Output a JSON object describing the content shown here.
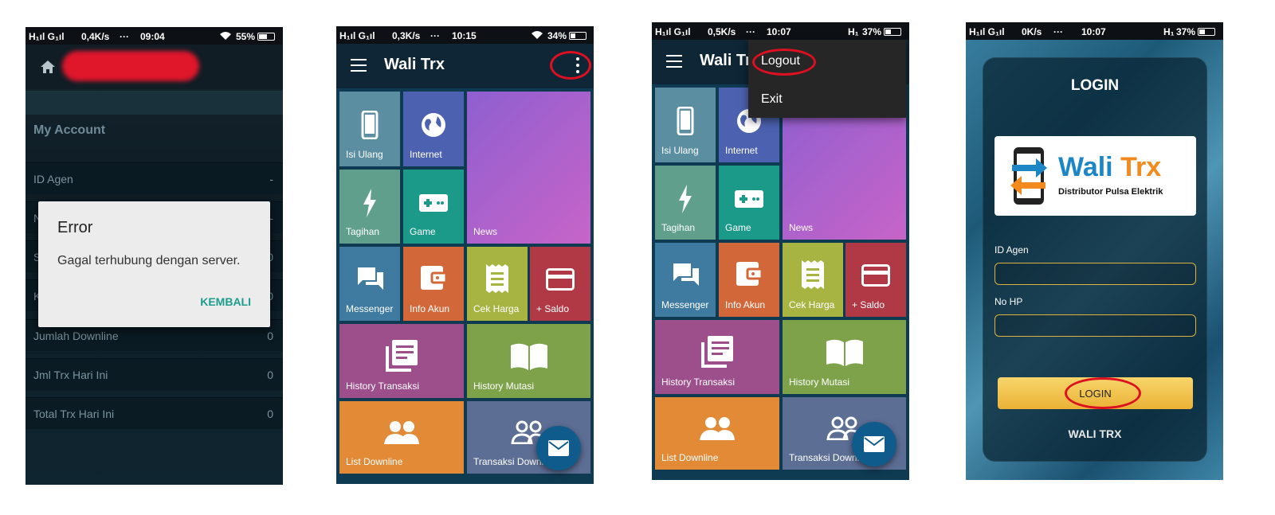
{
  "phone1": {
    "status": {
      "signal": "H₁ıl G₁ıl",
      "speed": "0,4K/s",
      "dots": "···",
      "time": "09:04",
      "battery": "55%"
    },
    "header": {
      "home_icon": "home-icon",
      "title_redacted": true
    },
    "account_title": "My Account",
    "rows": [
      {
        "label": "ID Agen",
        "value": "-"
      },
      {
        "label": "N",
        "value": "-"
      },
      {
        "label": "S",
        "value": "0"
      },
      {
        "label": "K",
        "value": "0"
      },
      {
        "label": "Jumlah Downline",
        "value": "0"
      },
      {
        "label": "Jml Trx Hari Ini",
        "value": "0"
      },
      {
        "label": "Total Trx Hari Ini",
        "value": "0"
      }
    ],
    "dialog": {
      "title": "Error",
      "message": "Gagal terhubung dengan server.",
      "button": "KEMBALI",
      "button_color": "#1c9c8c"
    }
  },
  "phone2": {
    "status": {
      "signal": "H₁ıl G₁ıl",
      "speed": "0,3K/s",
      "dots": "···",
      "time": "10:15",
      "battery": "34%"
    },
    "title": "Wali Trx",
    "tiles": {
      "isi_ulang": "Isi Ulang",
      "internet": "Internet",
      "news": "News",
      "tagihan": "Tagihan",
      "game": "Game",
      "messenger": "Messenger",
      "info_akun": "Info Akun",
      "cek_harga": "Cek Harga",
      "saldo": "+ Saldo",
      "history_transaksi": "History Transaksi",
      "history_mutasi": "History Mutasi",
      "list_downline": "List Downline",
      "transaksi_downline": "Transaksi Downli"
    }
  },
  "phone3": {
    "status": {
      "signal": "H₁ıl G₁ıl",
      "speed": "0,5K/s",
      "dots": "···",
      "time": "10:07",
      "network": "H₁",
      "battery": "37%"
    },
    "title": "Wali Tr",
    "menu": {
      "logout": "Logout",
      "exit": "Exit"
    },
    "tiles": {
      "isi_ulang": "Isi Ulang",
      "internet": "Internet",
      "news": "News",
      "tagihan": "Tagihan",
      "game": "Game",
      "messenger": "Messenger",
      "info_akun": "Info Akun",
      "cek_harga": "Cek Harga",
      "saldo": "+ Saldo",
      "history_transaksi": "History Transaksi",
      "history_mutasi": "History Mutasi",
      "list_downline": "List Downline",
      "transaksi_downline": "Transaksi Downli"
    }
  },
  "phone4": {
    "status": {
      "signal": "H₁ıl G₁ıl",
      "speed": "0K/s",
      "dots": "···",
      "time": "10:07",
      "network": "H₁",
      "battery": "37%"
    },
    "login_title": "LOGIN",
    "logo": {
      "brand_a": "Wali",
      "brand_b": " Trx",
      "tagline": "Distributor Pulsa Elektrik"
    },
    "id_label": "ID Agen",
    "id_value": "",
    "hp_label": "No HP",
    "hp_value": "",
    "login_button": "LOGIN",
    "footer": "WALI TRX"
  },
  "colors": {
    "annotation": "#dc1020",
    "tile_isi_ulang": "#5a8ea0",
    "tile_internet": "#4c62b0",
    "tile_news": "#b65ec9",
    "tile_tagihan": "#5f9f8c",
    "tile_game": "#1b9a8a",
    "tile_messenger": "#3f7aa0",
    "tile_info_akun": "#d2683a",
    "tile_cek_harga": "#a7b441",
    "tile_saldo": "#b13946",
    "tile_history_transaksi": "#9c4f8a",
    "tile_history_mutasi": "#7da24a",
    "tile_list_downline": "#e28a36",
    "tile_transaksi_downline": "#5d6e95",
    "fab": "#0f5c8c"
  }
}
